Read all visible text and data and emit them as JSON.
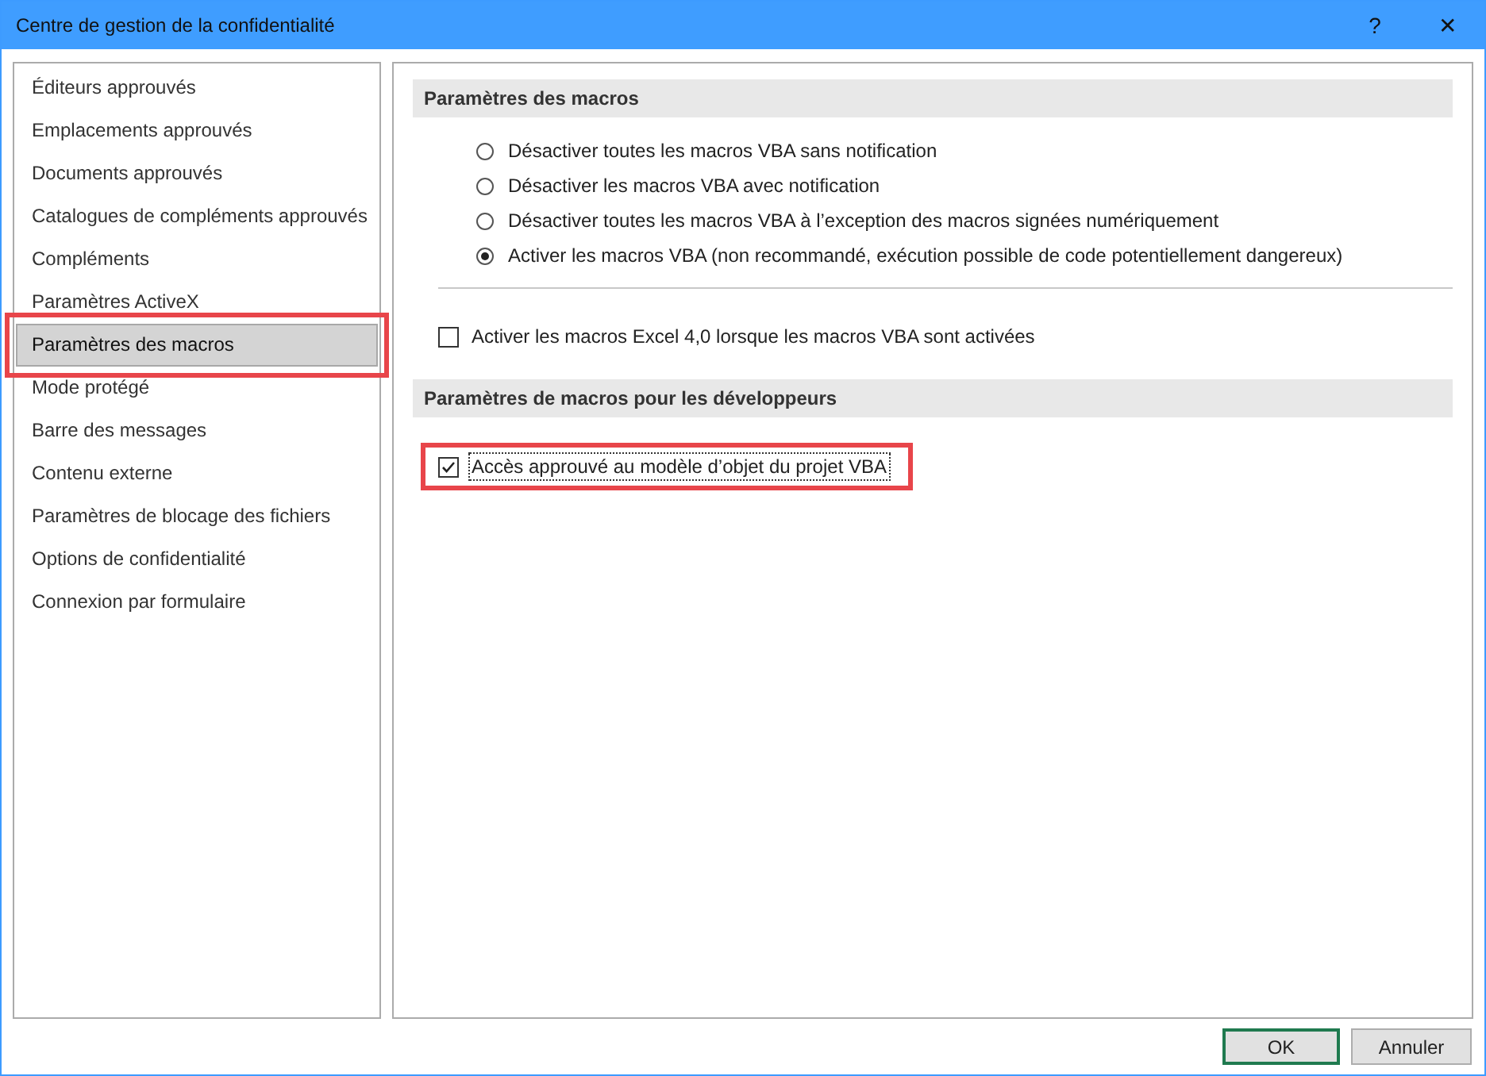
{
  "window": {
    "title": "Centre de gestion de la confidentialité",
    "help": "?",
    "close": "✕"
  },
  "sidebar": {
    "items": [
      {
        "label": "Éditeurs approuvés",
        "selected": false,
        "highlighted": false
      },
      {
        "label": "Emplacements approuvés",
        "selected": false,
        "highlighted": false
      },
      {
        "label": "Documents approuvés",
        "selected": false,
        "highlighted": false
      },
      {
        "label": "Catalogues de compléments approuvés",
        "selected": false,
        "highlighted": false
      },
      {
        "label": "Compléments",
        "selected": false,
        "highlighted": false
      },
      {
        "label": "Paramètres ActiveX",
        "selected": false,
        "highlighted": false
      },
      {
        "label": "Paramètres des macros",
        "selected": true,
        "highlighted": true
      },
      {
        "label": "Mode protégé",
        "selected": false,
        "highlighted": false
      },
      {
        "label": "Barre des messages",
        "selected": false,
        "highlighted": false
      },
      {
        "label": "Contenu externe",
        "selected": false,
        "highlighted": false
      },
      {
        "label": "Paramètres de blocage des fichiers",
        "selected": false,
        "highlighted": false
      },
      {
        "label": "Options de confidentialité",
        "selected": false,
        "highlighted": false
      },
      {
        "label": "Connexion par formulaire",
        "selected": false,
        "highlighted": false
      }
    ]
  },
  "sections": [
    {
      "title": "Paramètres des macros",
      "options": [
        {
          "kind": "radio",
          "label": "Désactiver toutes les macros VBA sans notification",
          "selected": false
        },
        {
          "kind": "radio",
          "label": "Désactiver les macros VBA avec notification",
          "selected": false
        },
        {
          "kind": "radio",
          "label": "Désactiver toutes les macros VBA à l’exception des macros signées numériquement",
          "selected": false
        },
        {
          "kind": "radio",
          "label": "Activer les macros VBA (non recommandé, exécution possible de code potentiellement dangereux)",
          "selected": true
        },
        {
          "kind": "divider"
        },
        {
          "kind": "checkbox",
          "label": "Activer les macros Excel 4,0 lorsque les macros VBA sont activées",
          "checked": false,
          "highlighted": false,
          "focused": false
        }
      ]
    },
    {
      "title": "Paramètres de macros pour les développeurs",
      "options": [
        {
          "kind": "checkbox",
          "label": "Accès approuvé au modèle d’objet du projet VBA",
          "checked": true,
          "highlighted": true,
          "focused": true
        }
      ]
    }
  ],
  "buttons": [
    {
      "label": "OK",
      "default": true
    },
    {
      "label": "Annuler",
      "default": false
    }
  ]
}
